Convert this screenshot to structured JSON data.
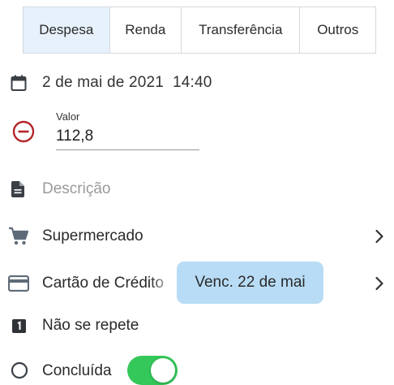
{
  "tabs": [
    {
      "label": "Despesa",
      "active": true
    },
    {
      "label": "Renda",
      "active": false
    },
    {
      "label": "Transferência",
      "active": false
    },
    {
      "label": "Outros",
      "active": false
    }
  ],
  "datetime": {
    "date": "2 de mai de 2021",
    "time": "14:40",
    "icon": "calendar-icon"
  },
  "amount": {
    "label": "Valor",
    "value": "112,8",
    "icon": "minus-circle-icon",
    "icon_color": "#b3262b"
  },
  "description": {
    "placeholder": "Descrição",
    "icon": "document-icon"
  },
  "category": {
    "label": "Supermercado",
    "icon": "cart-icon"
  },
  "account": {
    "label": "Cartão de Crédito",
    "due_badge": "Venc. 22 de mai",
    "icon": "credit-card-icon",
    "badge_color": "#b8dcf5"
  },
  "repeat": {
    "label": "Não se repete",
    "icon": "repeat-one-icon"
  },
  "completed": {
    "label": "Concluída",
    "on": true,
    "toggle_color": "#34c759"
  },
  "colors": {
    "active_tab_bg": "#e6f1fb",
    "icon_gray": "#5f6b78"
  }
}
